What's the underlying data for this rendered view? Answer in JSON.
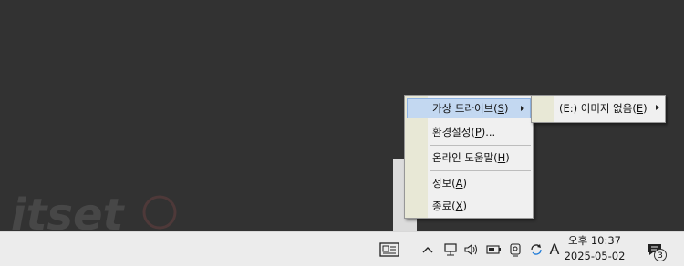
{
  "context_menu": {
    "items": [
      {
        "label": "가상 드라이브(",
        "mnemonic": "S",
        "suffix": ")",
        "highlighted": true,
        "has_submenu": true
      },
      {
        "label": "환경설정(",
        "mnemonic": "P",
        "suffix": ")..."
      },
      {
        "label": "온라인 도움말(",
        "mnemonic": "H",
        "suffix": ")"
      },
      {
        "label": "정보(",
        "mnemonic": "A",
        "suffix": ")"
      },
      {
        "label": "종료(",
        "mnemonic": "X",
        "suffix": ")"
      }
    ]
  },
  "submenu": {
    "item": {
      "label": "(E:) 이미지 없음(",
      "mnemonic": "E",
      "suffix": ")",
      "has_submenu": true
    }
  },
  "watermark": {
    "text": "itset"
  },
  "taskbar": {
    "icons": [
      "news-widget-icon",
      "chevron-up-icon",
      "network-icon",
      "volume-icon",
      "battery-icon",
      "webcam-icon",
      "sync-icon"
    ],
    "ime_indicator": "A",
    "clock": {
      "time": "오후 10:37",
      "date": "2025-05-02"
    },
    "notification_count": "3"
  },
  "colors": {
    "desktop": "#323232",
    "menu_bg": "#f0f0f0",
    "menu_gutter": "#e8e8d6",
    "highlight_bg": "#c3d8f1",
    "highlight_border": "#8db2e3",
    "taskbar_bg": "#ececec"
  }
}
